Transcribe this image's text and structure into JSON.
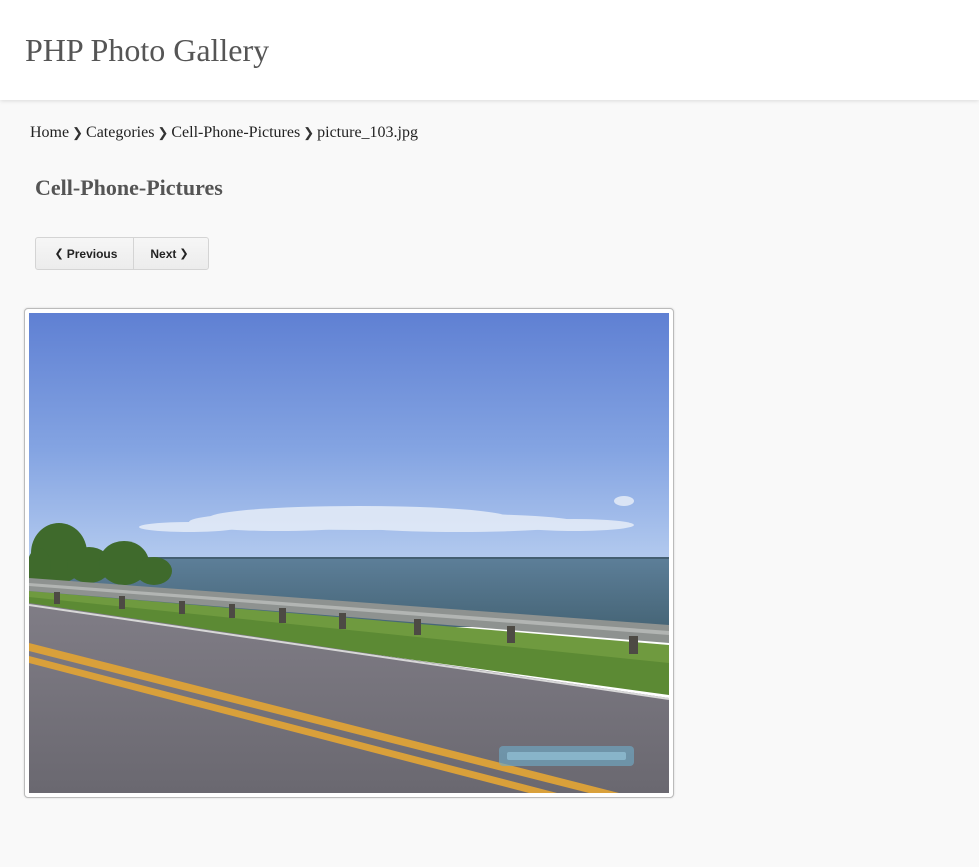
{
  "site": {
    "title": "PHP Photo Gallery"
  },
  "breadcrumb": {
    "items": [
      "Home",
      "Categories",
      "Cell-Phone-Pictures",
      "picture_103.jpg"
    ],
    "separator": "❯"
  },
  "page": {
    "title": "Cell-Phone-Pictures"
  },
  "pager": {
    "previous_label": "Previous",
    "next_label": "Next",
    "previous_icon": "chevron-left-icon",
    "next_icon": "chevron-right-icon"
  },
  "photo": {
    "filename": "picture_103.jpg",
    "scene": "coastal road with guardrail, lake and blue sky"
  },
  "colors": {
    "header_bg": "#ffffff",
    "page_bg": "#f9f9f9",
    "title_text": "#555555",
    "sky_top": "#5f80d3",
    "sky_bottom": "#a9c3ec",
    "water": "#4f6f88",
    "grass": "#6f9a3f",
    "road": "#6f6d75",
    "line_yellow": "#d9a03a"
  }
}
